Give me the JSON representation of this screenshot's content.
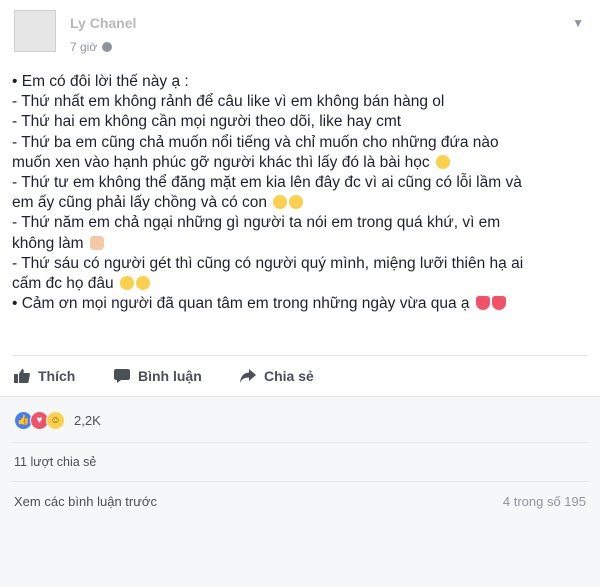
{
  "post": {
    "author": "Ly Chanel",
    "time": "7 giờ",
    "lines": [
      "• Em có đôi lời thế này ạ :",
      "- Thứ nhất em không rảnh để câu like vì em không bán hàng ol",
      "- Thứ hai em không cần mọi người theo dõi, like hay cmt",
      "- Thứ ba em cũng chả muốn nổi tiếng và chỉ muốn cho những đứa nào",
      "muốn xen vào hạnh phúc gỡ người khác thì lấy đó là bài học",
      "- Thứ tư em không thể đăng mặt em kia lên đây đc vì ai cũng có lỗi lầm và",
      "em ấy cũng phải lấy chồng và có con",
      "- Thứ năm em chả ngại những gì người ta nói em trong quá khứ, vì em",
      "không làm",
      "- Thứ sáu có người gét thì cũng có người quý mình, miệng lưỡi thiên hạ ai",
      "cấm đc họ đâu",
      "• Cảm ơn mọi người đã quan tâm em trong những ngày vừa qua ạ"
    ]
  },
  "actions": {
    "like": "Thích",
    "comment": "Bình luận",
    "share": "Chia sẻ"
  },
  "reactions": {
    "count": "2,2K",
    "types": [
      "like",
      "love",
      "haha"
    ]
  },
  "shares": "11 lượt chia sẻ",
  "comments": {
    "view_previous": "Xem các bình luận trước",
    "pager": "4 trong số 195"
  },
  "icons": {
    "privacy": "globe-icon",
    "menu": "chevron-down-icon",
    "like": "thumbs-up-icon",
    "comment": "comment-icon",
    "share": "share-arrow-icon"
  },
  "colors": {
    "like_reaction": "#4080ff",
    "love_reaction": "#f25268",
    "haha_reaction": "#fbd04c",
    "action_text": "#4b4f56"
  }
}
